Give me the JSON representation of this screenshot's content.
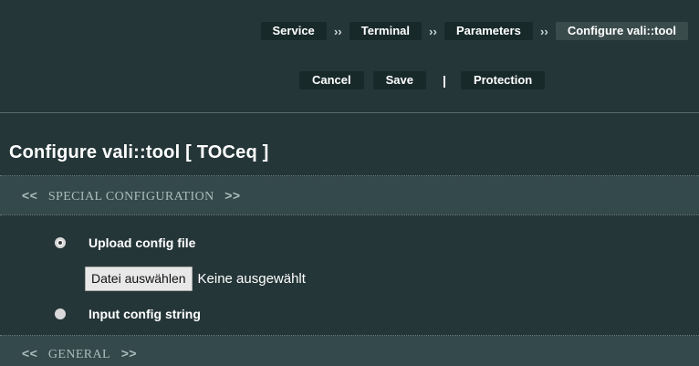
{
  "breadcrumb": {
    "items": [
      "Service",
      "Terminal",
      "Parameters",
      "Configure vali::tool"
    ],
    "separator": "››"
  },
  "actions": {
    "cancel": "Cancel",
    "save": "Save",
    "divider": "|",
    "protection": "Protection"
  },
  "page": {
    "title": "Configure vali::tool [ TOCeq ]"
  },
  "sections": {
    "special": {
      "open": "<<",
      "label": "SPECIAL CONFIGURATION",
      "close": ">>"
    },
    "general": {
      "open": "<<",
      "label": "GENERAL",
      "close": ">>"
    }
  },
  "special_config": {
    "options": [
      {
        "label": "Upload config file",
        "selected": true
      },
      {
        "label": "Input config string",
        "selected": false
      }
    ],
    "file_button": "Datei auswählen",
    "file_status": "Keine ausgewählt"
  },
  "colors": {
    "background": "#253638",
    "section_header": "#34494b",
    "button": "#18292a"
  }
}
